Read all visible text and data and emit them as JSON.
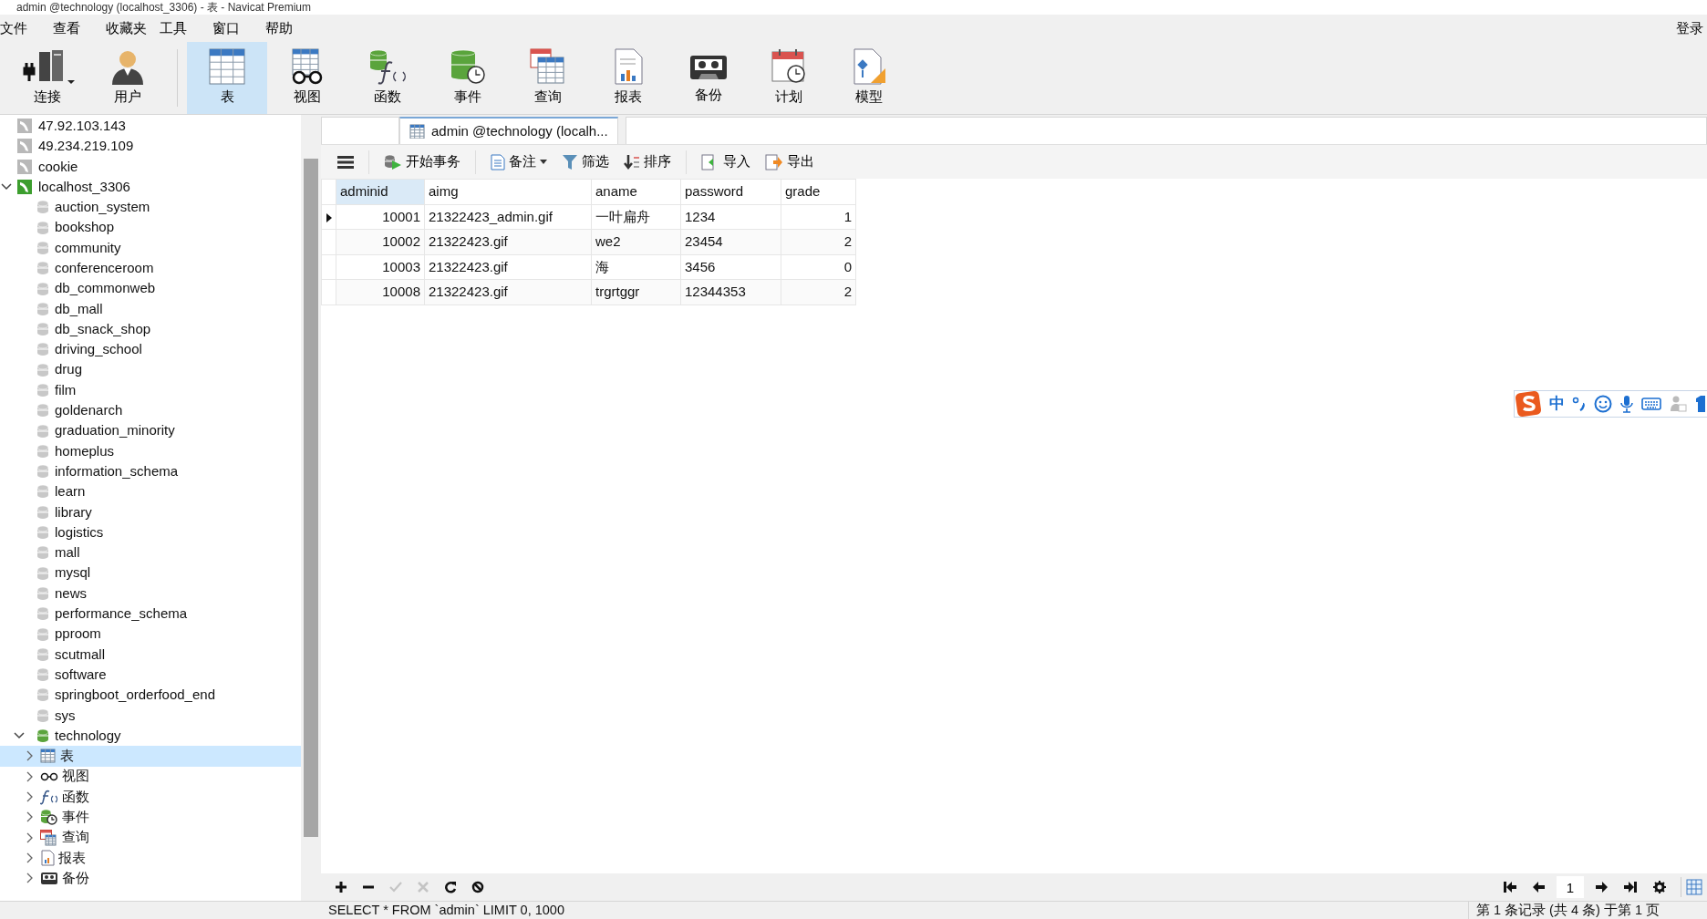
{
  "window": {
    "title": "admin @technology (localhost_3306) - 表 - Navicat Premium"
  },
  "menu": [
    "文件",
    "查看",
    "收藏夹",
    "工具",
    "窗口",
    "帮助"
  ],
  "login": "登录",
  "toolbar": [
    {
      "kind": "connection",
      "label": "连接",
      "selected": false
    },
    {
      "kind": "user",
      "label": "用户",
      "selected": false
    },
    {
      "kind": "table",
      "label": "表",
      "selected": true
    },
    {
      "kind": "view",
      "label": "视图",
      "selected": false
    },
    {
      "kind": "function",
      "label": "函数",
      "selected": false
    },
    {
      "kind": "event",
      "label": "事件",
      "selected": false
    },
    {
      "kind": "query",
      "label": "查询",
      "selected": false
    },
    {
      "kind": "report",
      "label": "报表",
      "selected": false
    },
    {
      "kind": "backup",
      "label": "备份",
      "selected": false
    },
    {
      "kind": "schedule",
      "label": "计划",
      "selected": false
    },
    {
      "kind": "model",
      "label": "模型",
      "selected": false
    }
  ],
  "tree": [
    {
      "kind": "server",
      "label": "47.92.103.143",
      "connected": false
    },
    {
      "kind": "server",
      "label": "49.234.219.109",
      "connected": false
    },
    {
      "kind": "server",
      "label": "cookie",
      "connected": false
    },
    {
      "kind": "server",
      "label": "localhost_3306",
      "connected": true,
      "expanded": true,
      "children": [
        {
          "kind": "database",
          "label": "auction_system",
          "open": false
        },
        {
          "kind": "database",
          "label": "bookshop",
          "open": false
        },
        {
          "kind": "database",
          "label": "community",
          "open": false
        },
        {
          "kind": "database",
          "label": "conferenceroom",
          "open": false
        },
        {
          "kind": "database",
          "label": "db_commonweb",
          "open": false
        },
        {
          "kind": "database",
          "label": "db_mall",
          "open": false
        },
        {
          "kind": "database",
          "label": "db_snack_shop",
          "open": false
        },
        {
          "kind": "database",
          "label": "driving_school",
          "open": false
        },
        {
          "kind": "database",
          "label": "drug",
          "open": false
        },
        {
          "kind": "database",
          "label": "film",
          "open": false
        },
        {
          "kind": "database",
          "label": "goldenarch",
          "open": false
        },
        {
          "kind": "database",
          "label": "graduation_minority",
          "open": false
        },
        {
          "kind": "database",
          "label": "homeplus",
          "open": false
        },
        {
          "kind": "database",
          "label": "information_schema",
          "open": false
        },
        {
          "kind": "database",
          "label": "learn",
          "open": false
        },
        {
          "kind": "database",
          "label": "library",
          "open": false
        },
        {
          "kind": "database",
          "label": "logistics",
          "open": false
        },
        {
          "kind": "database",
          "label": "mall",
          "open": false
        },
        {
          "kind": "database",
          "label": "mysql",
          "open": false
        },
        {
          "kind": "database",
          "label": "news",
          "open": false
        },
        {
          "kind": "database",
          "label": "performance_schema",
          "open": false
        },
        {
          "kind": "database",
          "label": "pproom",
          "open": false
        },
        {
          "kind": "database",
          "label": "scutmall",
          "open": false
        },
        {
          "kind": "database",
          "label": "software",
          "open": false
        },
        {
          "kind": "database",
          "label": "springboot_orderfood_end",
          "open": false
        },
        {
          "kind": "database",
          "label": "sys",
          "open": false
        },
        {
          "kind": "database",
          "label": "technology",
          "open": true,
          "expanded": true,
          "children": [
            {
              "kind": "table",
              "label": "表",
              "selected": true,
              "expanded": false
            },
            {
              "kind": "view",
              "label": "视图",
              "selected": false,
              "expanded": false
            },
            {
              "kind": "function",
              "label": "函数",
              "selected": false,
              "expanded": false
            },
            {
              "kind": "event",
              "label": "事件",
              "selected": false,
              "expanded": false
            },
            {
              "kind": "query",
              "label": "查询",
              "selected": false,
              "expanded": false
            },
            {
              "kind": "report",
              "label": "报表",
              "selected": false,
              "expanded": false
            },
            {
              "kind": "backup",
              "label": "备份",
              "selected": false,
              "expanded": false
            }
          ]
        }
      ]
    }
  ],
  "tabs": [
    {
      "label": "admin @technology (localh...",
      "selected": true
    }
  ],
  "table_toolbar": [
    {
      "kind": "menu"
    },
    {
      "kind": "transaction",
      "label": "开始事务"
    },
    {
      "kind": "memo",
      "label": "备注"
    },
    {
      "kind": "filter",
      "label": "筛选"
    },
    {
      "kind": "sort",
      "label": "排序"
    },
    {
      "kind": "import",
      "label": "导入"
    },
    {
      "kind": "export",
      "label": "导出"
    }
  ],
  "table": {
    "columns": [
      {
        "label": "adminid",
        "kind": "number",
        "selected": true
      },
      {
        "label": "aimg",
        "kind": "text",
        "selected": false
      },
      {
        "label": "aname",
        "kind": "text",
        "selected": false
      },
      {
        "label": "password",
        "kind": "text",
        "selected": false
      },
      {
        "label": "grade",
        "kind": "number",
        "selected": false
      }
    ],
    "rows": [
      {
        "current": true,
        "cells": [
          "10001",
          "21322423_admin.gif",
          "一叶扁舟",
          "1234",
          "1"
        ]
      },
      {
        "current": false,
        "cells": [
          "10002",
          "21322423.gif",
          "we2",
          "23454",
          "2"
        ]
      },
      {
        "current": false,
        "cells": [
          "10003",
          "21322423.gif",
          "海",
          "3456",
          "0"
        ]
      },
      {
        "current": false,
        "cells": [
          "10008",
          "21322423.gif",
          "trgrtggr",
          "12344353",
          "2"
        ]
      }
    ]
  },
  "ime_toolbar": {
    "mode": "中"
  },
  "record_buttons": [
    {
      "kind": "add",
      "disabled": false
    },
    {
      "kind": "delete",
      "disabled": false
    },
    {
      "kind": "apply",
      "disabled": true
    },
    {
      "kind": "discard",
      "disabled": true
    },
    {
      "kind": "refresh",
      "disabled": false
    },
    {
      "kind": "stop",
      "disabled": false
    }
  ],
  "pager": {
    "page": "1"
  },
  "status_bar": {
    "sql": "SELECT * FROM `admin` LIMIT 0, 1000",
    "records": "第 1 条记录 (共 4 条) 于第 1 页"
  }
}
